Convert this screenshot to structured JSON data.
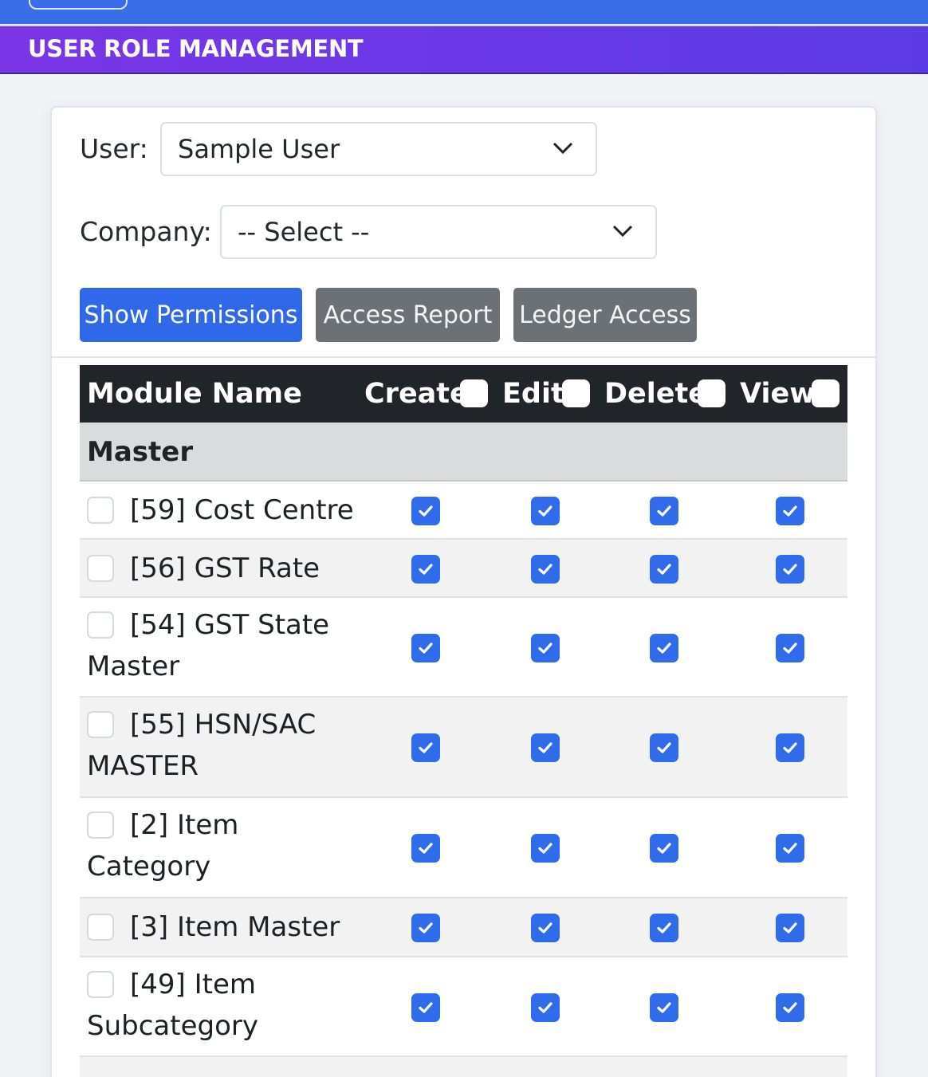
{
  "title": "USER ROLE MANAGEMENT",
  "filters": {
    "user_label": "User:",
    "user_value": "Sample User",
    "company_label": "Company:",
    "company_value": "-- Select --"
  },
  "buttons": {
    "show_permissions": "Show Permissions",
    "access_report": "Access Report",
    "ledger_access": "Ledger Access"
  },
  "table": {
    "headers": {
      "module": "Module Name",
      "create": "Create",
      "edit": "Edit",
      "delete": "Delete",
      "view": "View"
    },
    "header_checks": {
      "create": false,
      "edit": false,
      "delete": false,
      "view": false
    },
    "group": "Master",
    "rows": [
      {
        "line1": "[59] Cost Centre",
        "line2": "",
        "selected": false,
        "create": true,
        "edit": true,
        "delete": true,
        "view": true
      },
      {
        "line1": "[56] GST Rate",
        "line2": "",
        "selected": false,
        "create": true,
        "edit": true,
        "delete": true,
        "view": true
      },
      {
        "line1": "[54] GST State",
        "line2": "Master",
        "selected": false,
        "create": true,
        "edit": true,
        "delete": true,
        "view": true
      },
      {
        "line1": "[55] HSN/SAC",
        "line2": "MASTER",
        "selected": false,
        "create": true,
        "edit": true,
        "delete": true,
        "view": true
      },
      {
        "line1": "[2] Item",
        "line2": "Category",
        "selected": false,
        "create": true,
        "edit": true,
        "delete": true,
        "view": true
      },
      {
        "line1": "[3] Item Master",
        "line2": "",
        "selected": false,
        "create": true,
        "edit": true,
        "delete": true,
        "view": true
      },
      {
        "line1": "[49] Item",
        "line2": "Subcategory",
        "selected": false,
        "create": true,
        "edit": true,
        "delete": true,
        "view": true
      }
    ]
  },
  "colors": {
    "primary": "#2f69ea",
    "secondary": "#6b7177",
    "title_gradient_start": "#7b36e6",
    "title_gradient_end": "#5b3ae6",
    "table_header": "#212529"
  }
}
